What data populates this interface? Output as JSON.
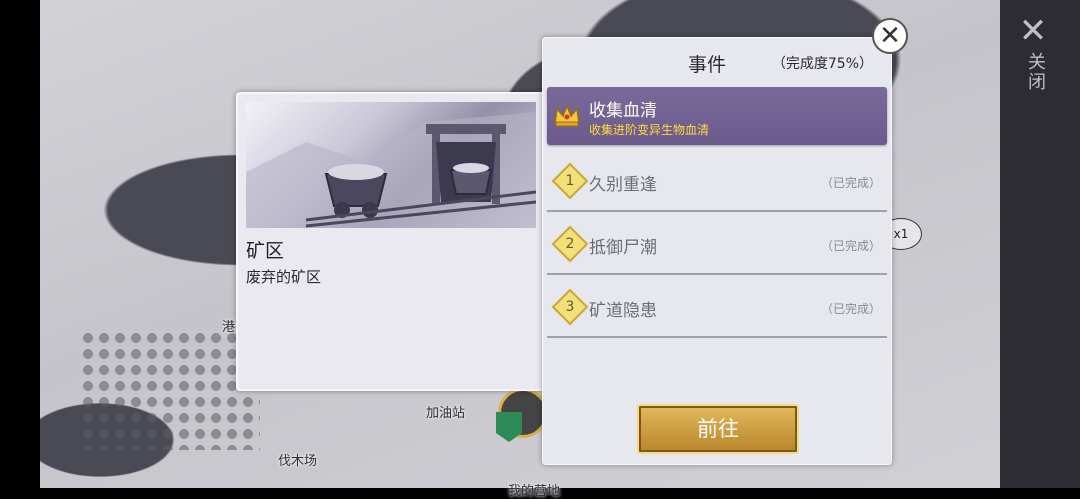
{
  "map": {
    "labels": {
      "gas_station": "加油站",
      "lumber_yard": "伐木场",
      "port": "港口",
      "my_camp": "我的营地"
    },
    "sign": "x1"
  },
  "side": {
    "close_icon": "close-icon",
    "close_label": "关闭"
  },
  "location": {
    "title": "矿区",
    "description": "废弃的矿区"
  },
  "events": {
    "title": "事件",
    "progress": "（完成度75%）",
    "active": {
      "name": "收集血清",
      "description": "收集进阶变异生物血清",
      "icon": "crown-icon"
    },
    "tasks": [
      {
        "num": "1",
        "name": "久别重逢",
        "status": "（已完成）"
      },
      {
        "num": "2",
        "name": "抵御尸潮",
        "status": "（已完成）"
      },
      {
        "num": "3",
        "name": "矿道隐患",
        "status": "（已完成）"
      }
    ],
    "go_label": "前往",
    "close_icon": "close-icon"
  },
  "colors": {
    "active_bg": "#6b5b8c",
    "active_desc": "#ffd93a",
    "button_gold": "#c99a3d"
  }
}
